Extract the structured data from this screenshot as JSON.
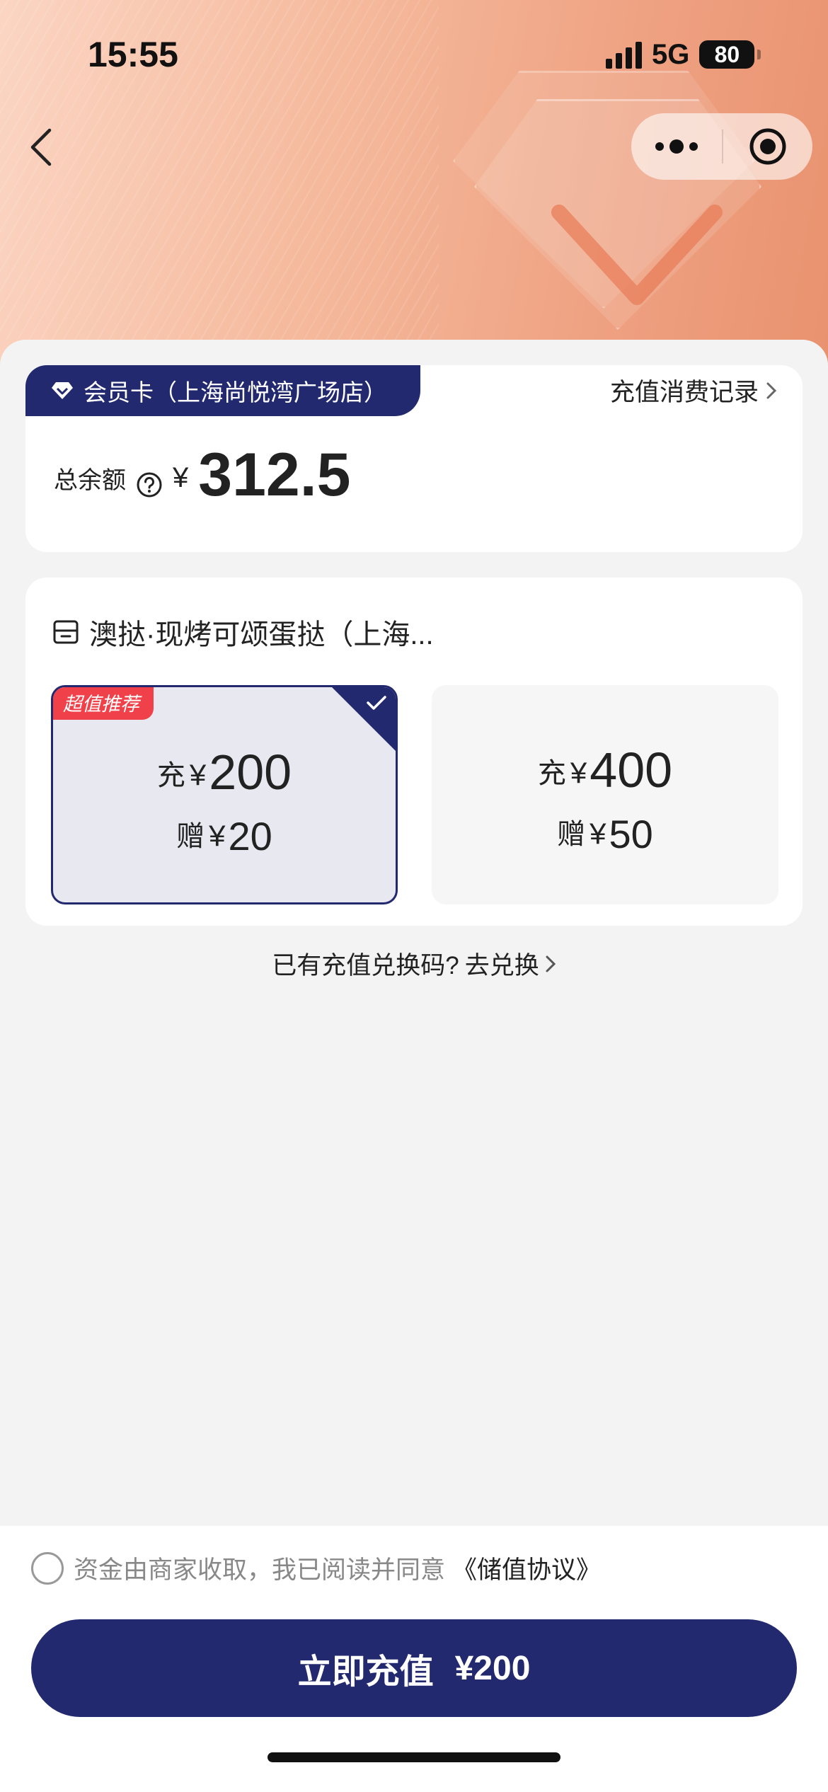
{
  "status_bar": {
    "time": "15:55",
    "network": "5G",
    "battery": "80"
  },
  "nav": {
    "back_icon": "chevron-left-icon",
    "more_icon": "more-dots-icon",
    "close_icon": "target-icon"
  },
  "member_card": {
    "title": "会员卡（上海尚悦湾广场店）",
    "record_link": "充值消费记录",
    "balance_label": "总余额",
    "currency": "¥",
    "balance": "312.5"
  },
  "store": {
    "name": "澳挞·现烤可颂蛋挞（上海..."
  },
  "options": [
    {
      "badge": "超值推荐",
      "charge_prefix": "充",
      "charge_currency": "¥",
      "charge": "200",
      "gift_prefix": "赠",
      "gift_currency": "¥",
      "gift": "20",
      "selected": true
    },
    {
      "badge": "",
      "charge_prefix": "充",
      "charge_currency": "¥",
      "charge": "400",
      "gift_prefix": "赠",
      "gift_currency": "¥",
      "gift": "50",
      "selected": false
    }
  ],
  "redeem": {
    "question": "已有充值兑换码?",
    "action": "去兑换"
  },
  "agreement": {
    "text": "资金由商家收取，我已阅读并同意",
    "link": "《储值协议》"
  },
  "pay_button": {
    "label": "立即充值",
    "amount": "¥200"
  },
  "colors": {
    "primary": "#22296e",
    "badge_red": "#f0414a",
    "hero_peach": "#f2ab8c"
  }
}
